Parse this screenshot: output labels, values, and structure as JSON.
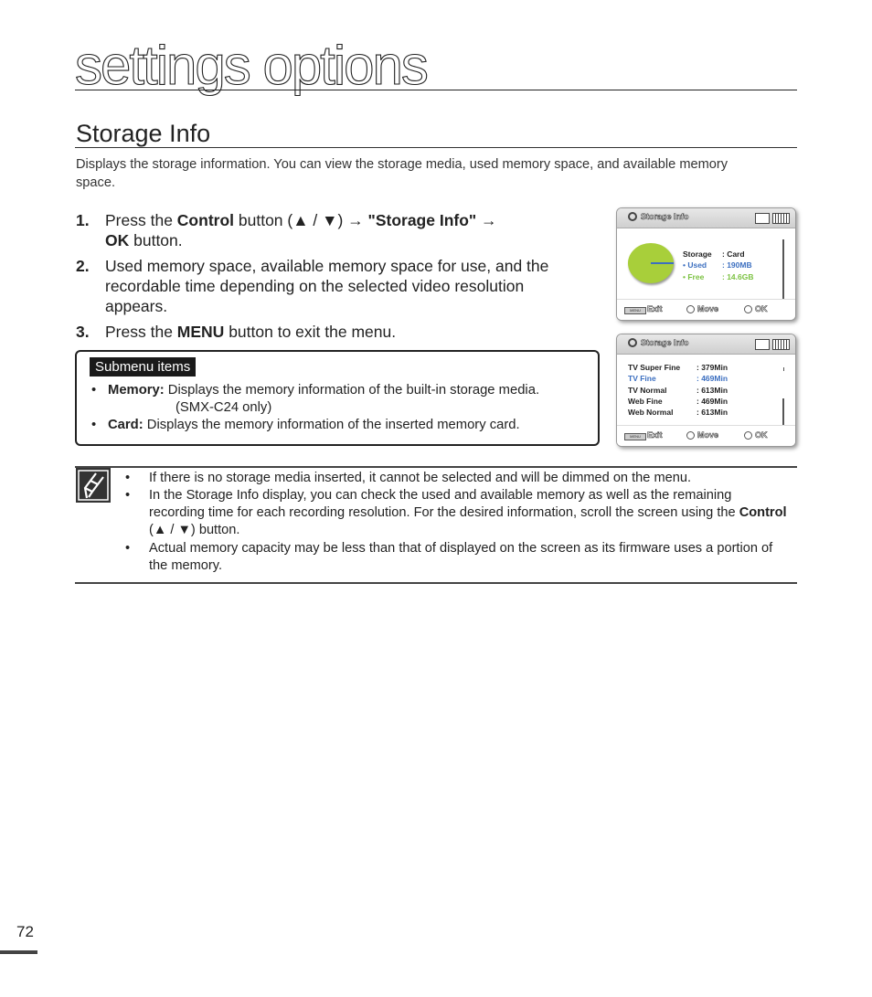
{
  "page": {
    "title": "settings options",
    "section_heading": "Storage Info",
    "intro": "Displays the storage information. You can view the storage media, used memory space, and available memory space.",
    "page_number": "72"
  },
  "steps": [
    {
      "num": "1.",
      "parts": [
        {
          "t": "Press the ",
          "b": false
        },
        {
          "t": "Control",
          "b": true
        },
        {
          "t": " button (▲ / ▼) → ",
          "b": false
        },
        {
          "t": "\"Storage Info\" →",
          "b": true
        }
      ],
      "line2": [
        {
          "t": "OK",
          "b": true
        },
        {
          "t": " button.",
          "b": false
        }
      ]
    },
    {
      "num": "2.",
      "lines": [
        "Used memory space, available memory space for use, and the",
        "recordable time depending on the selected video resolution",
        "appears."
      ]
    },
    {
      "num": "3.",
      "parts": [
        {
          "t": "Press the ",
          "b": false
        },
        {
          "t": "MENU",
          "b": true
        },
        {
          "t": " button to exit the menu.",
          "b": false
        }
      ]
    }
  ],
  "submenu": {
    "label": "Submenu items",
    "items": [
      {
        "name": "Memory:",
        "text": " Displays the memory information of the built-in storage media.",
        "text2": "(SMX-C24 only)"
      },
      {
        "name": "Card:",
        "text": " Displays the memory information of the inserted memory card."
      }
    ]
  },
  "notes": {
    "items": [
      "If there is no storage media inserted, it cannot be selected and will be dimmed on the menu.",
      "In the Storage Info display, you can check the used and available memory as well as the remaining recording time for each recording resolution. For the desired information, scroll the screen using the ",
      "Actual memory capacity may be less than that of displayed on the screen as its firmware uses a portion of the memory."
    ],
    "item2_bold": "Control",
    "item2_tail": " (▲ / ▼) button."
  },
  "lcd1": {
    "title": "Storage Info",
    "storage_label": "Storage",
    "storage_value": ": Card",
    "used_label": "• Used",
    "used_value": ": 190MB",
    "free_label": "• Free",
    "free_value": ": 14.6GB",
    "used_color": "#3c6fc0",
    "free_color": "#7cc242",
    "pie": {
      "used_mb": 190,
      "free_gb": 14.6
    },
    "footer": {
      "menu": "MENU",
      "exit": "Exit",
      "move": "Move",
      "ok": "OK"
    }
  },
  "lcd2": {
    "title": "Storage Info",
    "rows": [
      {
        "label": "TV Super Fine",
        "value": ": 379Min",
        "highlight": false
      },
      {
        "label": "TV Fine",
        "value": ": 469Min",
        "highlight": true
      },
      {
        "label": "TV Normal",
        "value": ": 613Min",
        "highlight": false
      },
      {
        "label": "Web Fine",
        "value": ": 469Min",
        "highlight": false
      },
      {
        "label": "Web Normal",
        "value": ": 613Min",
        "highlight": false
      }
    ],
    "footer": {
      "menu": "MENU",
      "exit": "Exit",
      "move": "Move",
      "ok": "OK"
    }
  }
}
